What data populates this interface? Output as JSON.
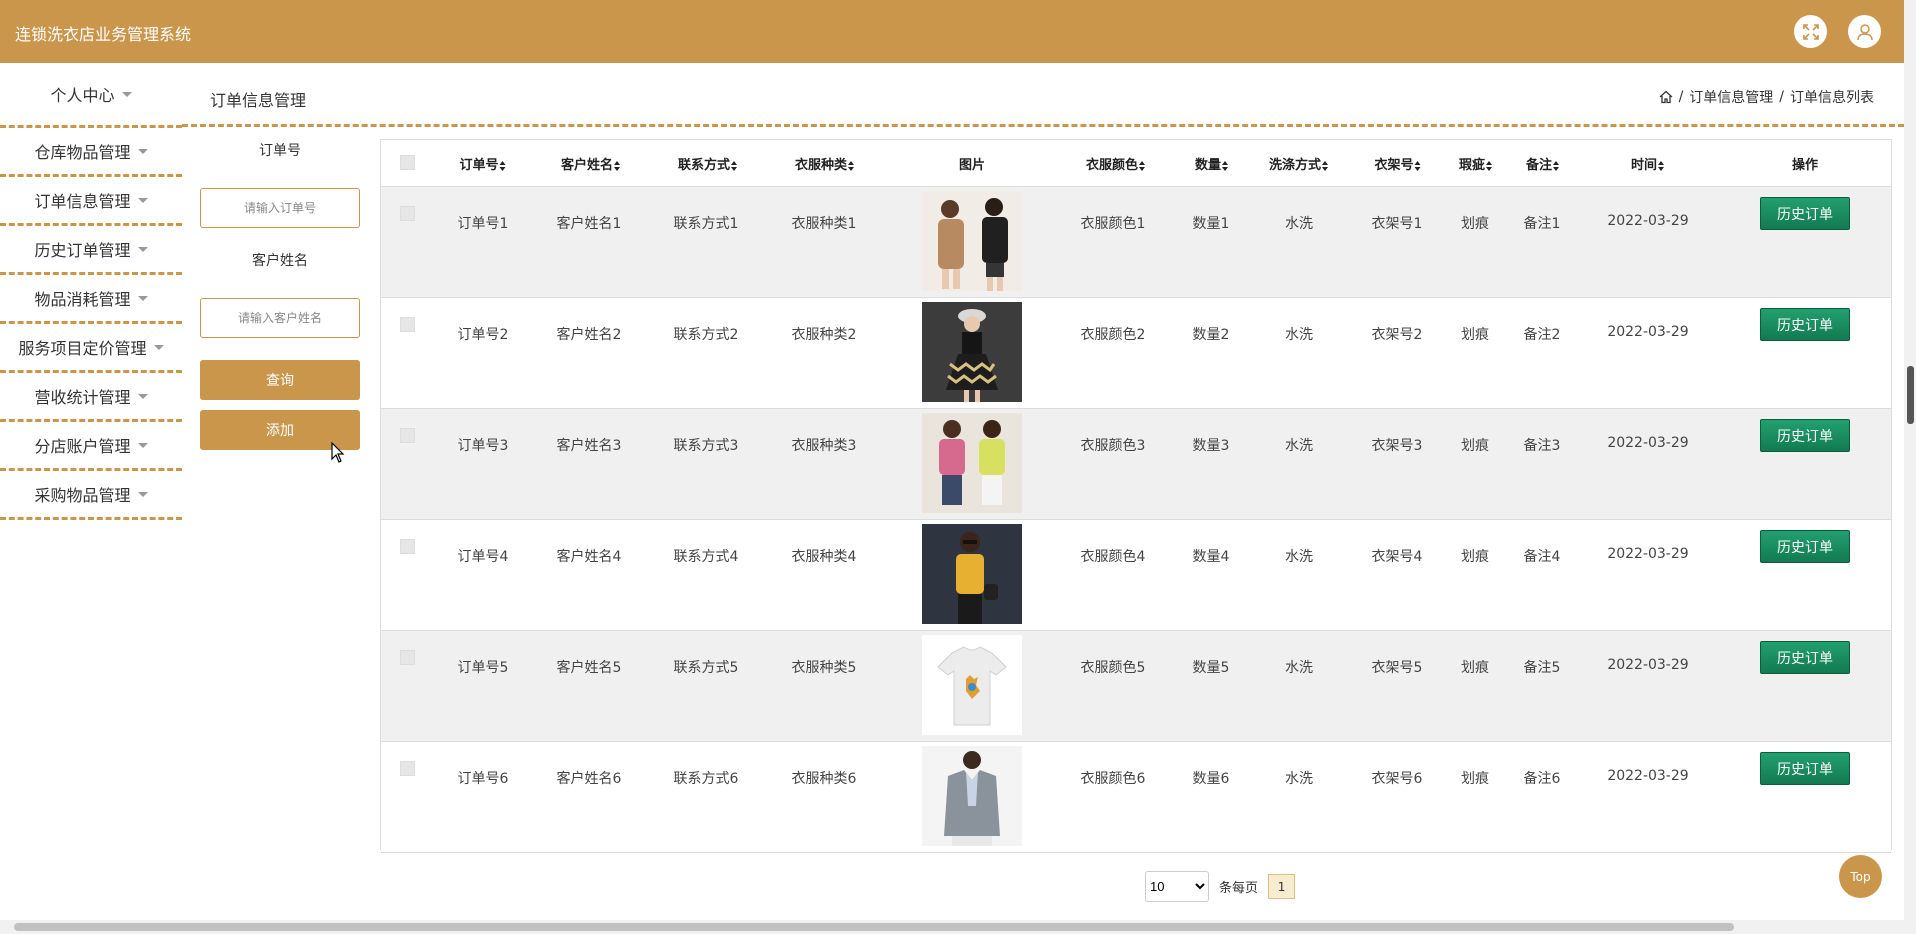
{
  "app": {
    "title": "连锁洗衣店业务管理系统"
  },
  "header": {
    "fullscreen_icon": "expand-icon",
    "user_icon": "user-icon"
  },
  "sidebar": {
    "items": [
      {
        "label": "个人中心"
      },
      {
        "label": "仓库物品管理"
      },
      {
        "label": "订单信息管理"
      },
      {
        "label": "历史订单管理"
      },
      {
        "label": "物品消耗管理"
      },
      {
        "label": "服务项目定价管理"
      },
      {
        "label": "营收统计管理"
      },
      {
        "label": "分店账户管理"
      },
      {
        "label": "采购物品管理"
      }
    ]
  },
  "page": {
    "title": "订单信息管理"
  },
  "breadcrumb": {
    "level1": "订单信息管理",
    "level2": "订单信息列表",
    "sep": "/"
  },
  "search": {
    "order_label": "订单号",
    "order_placeholder": "请输入订单号",
    "customer_label": "客户姓名",
    "customer_placeholder": "请输入客户姓名",
    "query_button": "查询",
    "add_button": "添加"
  },
  "table": {
    "columns": [
      "订单号",
      "客户姓名",
      "联系方式",
      "衣服种类",
      "图片",
      "衣服颜色",
      "数量",
      "洗涤方式",
      "衣架号",
      "瑕疵",
      "备注",
      "时间",
      "操作"
    ],
    "rows": [
      {
        "order": "订单号1",
        "customer": "客户姓名1",
        "contact": "联系方式1",
        "kind": "衣服种类1",
        "color": "衣服颜色1",
        "qty": "数量1",
        "wash": "水洗",
        "hanger": "衣架号1",
        "flaw": "划痕",
        "note": "备注1",
        "time": "2022-03-29",
        "action": "历史订单"
      },
      {
        "order": "订单号2",
        "customer": "客户姓名2",
        "contact": "联系方式2",
        "kind": "衣服种类2",
        "color": "衣服颜色2",
        "qty": "数量2",
        "wash": "水洗",
        "hanger": "衣架号2",
        "flaw": "划痕",
        "note": "备注2",
        "time": "2022-03-29",
        "action": "历史订单"
      },
      {
        "order": "订单号3",
        "customer": "客户姓名3",
        "contact": "联系方式3",
        "kind": "衣服种类3",
        "color": "衣服颜色3",
        "qty": "数量3",
        "wash": "水洗",
        "hanger": "衣架号3",
        "flaw": "划痕",
        "note": "备注3",
        "time": "2022-03-29",
        "action": "历史订单"
      },
      {
        "order": "订单号4",
        "customer": "客户姓名4",
        "contact": "联系方式4",
        "kind": "衣服种类4",
        "color": "衣服颜色4",
        "qty": "数量4",
        "wash": "水洗",
        "hanger": "衣架号4",
        "flaw": "划痕",
        "note": "备注4",
        "time": "2022-03-29",
        "action": "历史订单"
      },
      {
        "order": "订单号5",
        "customer": "客户姓名5",
        "contact": "联系方式5",
        "kind": "衣服种类5",
        "color": "衣服颜色5",
        "qty": "数量5",
        "wash": "水洗",
        "hanger": "衣架号5",
        "flaw": "划痕",
        "note": "备注5",
        "time": "2022-03-29",
        "action": "历史订单"
      },
      {
        "order": "订单号6",
        "customer": "客户姓名6",
        "contact": "联系方式6",
        "kind": "衣服种类6",
        "color": "衣服颜色6",
        "qty": "数量6",
        "wash": "水洗",
        "hanger": "衣架号6",
        "flaw": "划痕",
        "note": "备注6",
        "time": "2022-03-29",
        "action": "历史订单"
      }
    ]
  },
  "pagination": {
    "page_size": "10",
    "per_page_label": "条每页",
    "current_page": "1"
  },
  "back_to_top": "Top",
  "colors": {
    "brand": "#c9964c",
    "action_green": "#1a8c60"
  }
}
